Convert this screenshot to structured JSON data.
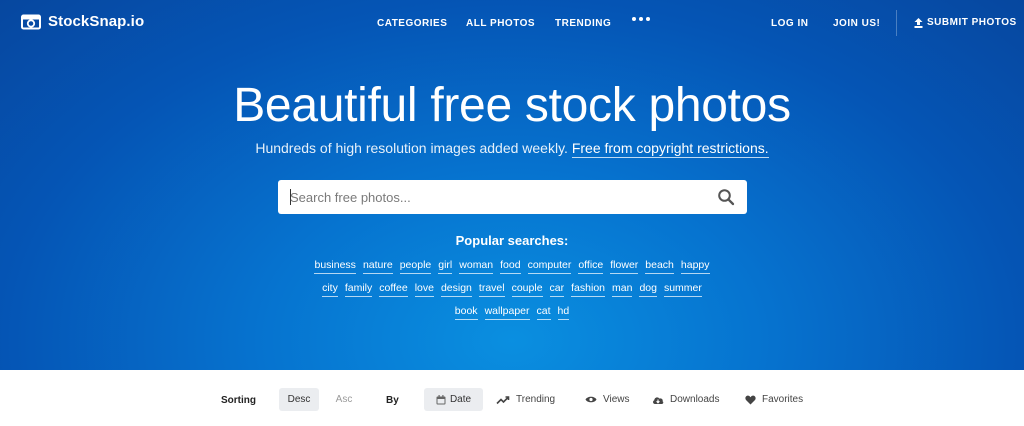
{
  "brand": {
    "name": "StockSnap.io"
  },
  "nav": {
    "categories": "CATEGORIES",
    "all_photos": "ALL PHOTOS",
    "trending": "TRENDING",
    "log_in": "LOG IN",
    "join": "JOIN US!",
    "submit": "SUBMIT PHOTOS"
  },
  "hero": {
    "title": "Beautiful free stock photos",
    "subtitle": "Hundreds of high resolution images added weekly.",
    "subtitle_link": "Free from copyright restrictions."
  },
  "search": {
    "placeholder": "Search free photos..."
  },
  "popular": {
    "title": "Popular searches:",
    "row1": [
      "business",
      "nature",
      "people",
      "girl",
      "woman",
      "food",
      "computer",
      "office",
      "flower",
      "beach",
      "happy"
    ],
    "row2": [
      "city",
      "family",
      "coffee",
      "love",
      "design",
      "travel",
      "couple",
      "car",
      "fashion",
      "man",
      "dog",
      "summer"
    ],
    "row3": [
      "book",
      "wallpaper",
      "cat",
      "hd"
    ]
  },
  "sorting": {
    "label": "Sorting",
    "desc": "Desc",
    "asc": "Asc",
    "by_label": "By",
    "date": "Date",
    "trending": "Trending",
    "views": "Views",
    "downloads": "Downloads",
    "favorites": "Favorites"
  },
  "colors": {
    "hero_blue": "#0555b5",
    "hero_glow": "#0a8fe0",
    "pill_bg": "#ebedf0"
  }
}
